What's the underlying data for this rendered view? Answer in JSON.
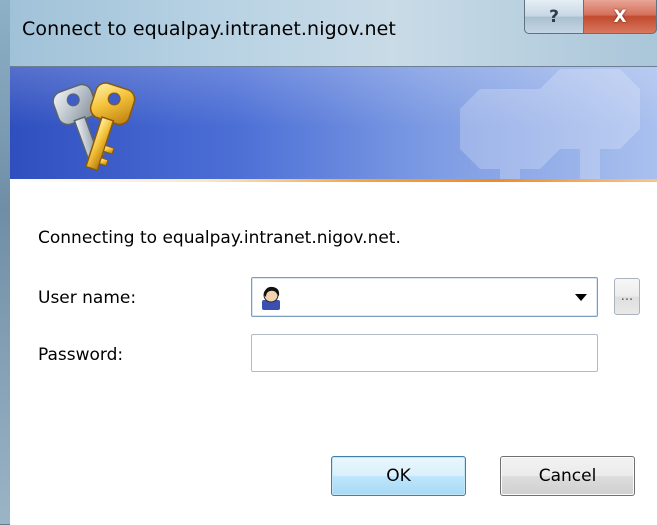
{
  "window": {
    "title": "Connect to equalpay.intranet.nigov.net",
    "help_glyph": "?",
    "close_glyph": "X"
  },
  "banner": {
    "icon": "keys-icon",
    "colors": {
      "gradient_start": "#2f4fbf",
      "gradient_end": "#a9c0ee",
      "accent_line": "#f08a22"
    }
  },
  "dialog": {
    "message": "Connecting to equalpay.intranet.nigov.net.",
    "username": {
      "label": "User name:",
      "value": "",
      "icon": "user-icon"
    },
    "password": {
      "label": "Password:",
      "value": ""
    },
    "browse_label": "..."
  },
  "buttons": {
    "ok_label": "OK",
    "cancel_label": "Cancel"
  }
}
